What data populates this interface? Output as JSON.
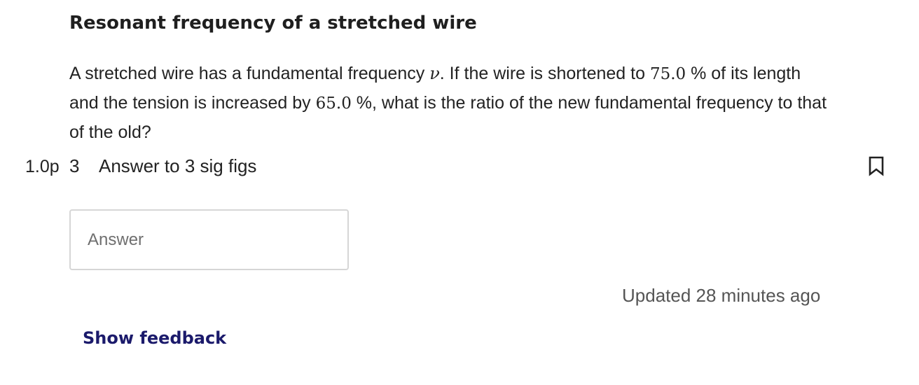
{
  "question": {
    "title": "Resonant frequency of a stretched wire",
    "text_1": "A stretched wire has a fundamental frequency ",
    "symbol_nu": "ν",
    "text_2": ". If the wire is shortened to ",
    "value_length": "75.0",
    "text_3": " % of its length and the tension is increased by ",
    "value_tension": "65.0",
    "text_4": " %, what is the ratio of the new fundamental frequency to that of the old?",
    "points": "1.0p",
    "number": "3",
    "prompt": "Answer to 3 sig figs"
  },
  "answer": {
    "value": "",
    "placeholder": "Answer"
  },
  "status": {
    "updated": "Updated 28 minutes ago"
  },
  "feedback": {
    "label": "Show feedback"
  },
  "icons": {
    "bookmark": "bookmark-icon"
  },
  "colors": {
    "link": "#1b1a6b",
    "text": "#222222",
    "muted": "#555555",
    "border": "#d6d6d6"
  }
}
